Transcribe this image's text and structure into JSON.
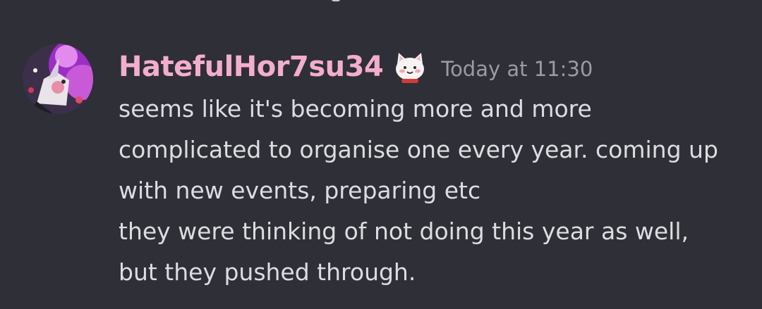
{
  "message": {
    "author": {
      "name": "HatefulHor7su34",
      "avatar_icon": "unicorn-avatar-icon",
      "badge_icon": "cat-badge-icon",
      "name_color": "#f3aecd"
    },
    "timestamp": "Today at 11:30",
    "lines": [
      "seems like it's becoming more and more",
      "complicated to organise one every year. coming up",
      "with new events, preparing etc",
      "they were thinking of not doing this year as well,",
      "but they pushed through."
    ]
  },
  "colors": {
    "background": "#2f2f37",
    "text": "#dcdde1",
    "timestamp": "#9a9ba3"
  }
}
